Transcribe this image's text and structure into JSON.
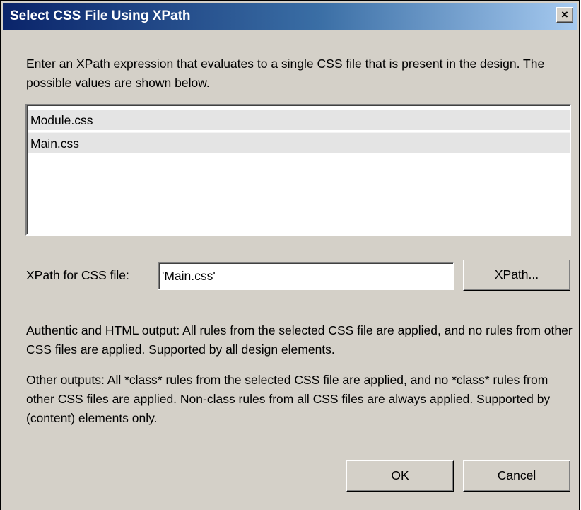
{
  "dialog": {
    "title": "Select CSS File Using XPath",
    "close_glyph": "×",
    "intro_text": "Enter an XPath expression that evaluates to a single CSS file that is present in the design. The possible values are shown below.",
    "css_files": [
      "Module.css",
      "Main.css"
    ],
    "xpath_label": "XPath for CSS file:",
    "xpath_value": "'Main.css'",
    "xpath_button": "XPath...",
    "note_html_output": "Authentic and HTML output: All rules from the selected CSS file are applied, and no rules from other CSS files are applied. Supported by all design elements.",
    "note_other_outputs": "Other outputs: All *class* rules from the selected CSS file are applied, and no *class* rules from other CSS files are applied. Non-class rules from all CSS files are always applied. Supported by (content) elements only.",
    "ok_button": "OK",
    "cancel_button": "Cancel"
  },
  "colors": {
    "titlebar_start": "#0a246a",
    "titlebar_end": "#a6caf0",
    "dialog_background": "#d4d0c8"
  },
  "icons": {
    "close": "close-icon"
  }
}
